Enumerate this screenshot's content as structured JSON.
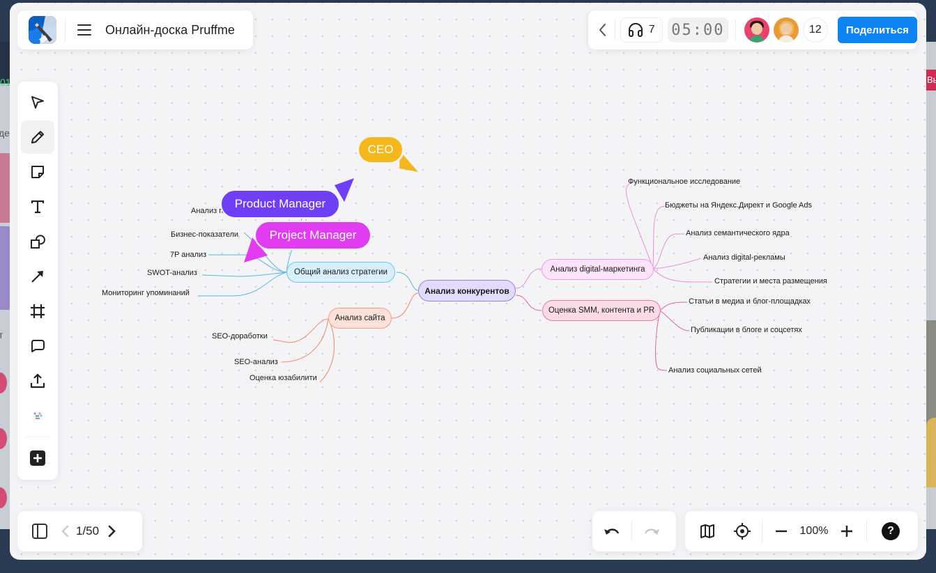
{
  "app": {
    "board_title": "Онлайн-доска Pruffme",
    "logo": "pruffme-logo"
  },
  "header": {
    "back_icon": "chevron-left-icon",
    "audio": {
      "icon": "headphones-icon",
      "count": "7"
    },
    "timer": "05:00",
    "participants": {
      "count": "12",
      "avatars": [
        "avatar-woman-dark-hair",
        "avatar-woman-blonde"
      ]
    },
    "share_label": "Поделиться",
    "share_color": "#0d84f2"
  },
  "toolbar": {
    "tools": [
      {
        "name": "select",
        "icon": "cursor-arrow-icon"
      },
      {
        "name": "pen",
        "icon": "pencil-icon",
        "active": true
      },
      {
        "name": "sticky-note",
        "icon": "sticky-note-icon"
      },
      {
        "name": "text",
        "icon": "text-icon"
      },
      {
        "name": "shapes",
        "icon": "shapes-icon"
      },
      {
        "name": "arrow",
        "icon": "arrow-icon"
      },
      {
        "name": "frame",
        "icon": "frame-icon"
      },
      {
        "name": "comment",
        "icon": "comment-icon"
      },
      {
        "name": "upload",
        "icon": "upload-icon"
      },
      {
        "name": "templates",
        "icon": "templates-icon"
      },
      {
        "name": "more",
        "icon": "plus-square-icon"
      }
    ]
  },
  "footer": {
    "pages": {
      "current": "1/50",
      "sidebar_icon": "sidebar-toggle-icon"
    },
    "undo_icon": "undo-icon",
    "redo_icon": "redo-icon",
    "map_icon": "minimap-icon",
    "center_icon": "crosshair-icon",
    "zoom_level": "100%",
    "help_label": "?"
  },
  "mindmap": {
    "root": "Анализ конкурентов",
    "branches": {
      "strategy": {
        "label": "Общий анализ стратегии",
        "color": "#4fb8e0",
        "children": [
          "Анализ п",
          "Бизнес-показатели",
          "7P анализ",
          "SWOT-анализ",
          "Мониторинг упоминаний"
        ]
      },
      "site": {
        "label": "Анализ сайта",
        "color": "#ef8a6a",
        "children": [
          "SEO-доработки",
          "SEO-анализ",
          "Оценка юзабилити"
        ]
      },
      "digital": {
        "label": "Анализ digital-маркетинга",
        "color": "#ee8be0",
        "children": [
          "Функциональное исследование",
          "Бюджеты на Яндекс.Директ и Google Ads",
          "Анализ семантического ядра",
          "Анализ digital-рекламы",
          "Стратегии и места размещения"
        ]
      },
      "smm": {
        "label": "Оценка SMM, контента и PR",
        "color": "#e2659a",
        "children": [
          "Статьи в медиа и блог-площадках",
          "Публикации в блоге и соцсетях",
          "Анализ социальных сетей"
        ]
      }
    }
  },
  "cursors": [
    {
      "label": "CEO",
      "color": "#f4b81c"
    },
    {
      "label": "Product Manager",
      "color": "#6e3ff5"
    },
    {
      "label": "Project Manager",
      "color": "#e23cf0"
    }
  ]
}
